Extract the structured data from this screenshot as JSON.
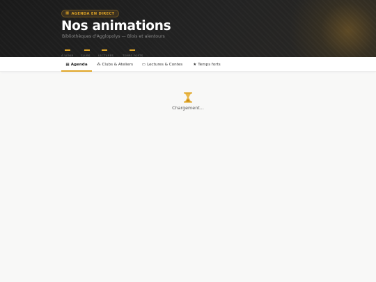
{
  "hero": {
    "badge": "AGENDA EN DIRECT",
    "badge_icon": "calendar-icon",
    "title": "Nos animations",
    "subtitle": "Bibliothèques d'Agglopolys — Blois et alentours",
    "stats": [
      {
        "label": "À VENIR"
      },
      {
        "label": "CLUBS"
      },
      {
        "label": "LECTURES"
      },
      {
        "label": "TEMPS FORTS"
      }
    ]
  },
  "tabs": [
    {
      "label": "Agenda",
      "icon": "calendar-icon",
      "active": true
    },
    {
      "label": "Clubs & Ateliers",
      "icon": "group-icon",
      "active": false
    },
    {
      "label": "Lectures & Contes",
      "icon": "book-icon",
      "active": false
    },
    {
      "label": "Temps forts",
      "icon": "star-icon",
      "active": false
    }
  ],
  "loading": {
    "text": "Chargement...",
    "icon": "hourglass-icon"
  },
  "colors": {
    "accent": "#e0a526",
    "hero_bg": "#1f1f1f",
    "page_bg": "#f8f8f7"
  }
}
